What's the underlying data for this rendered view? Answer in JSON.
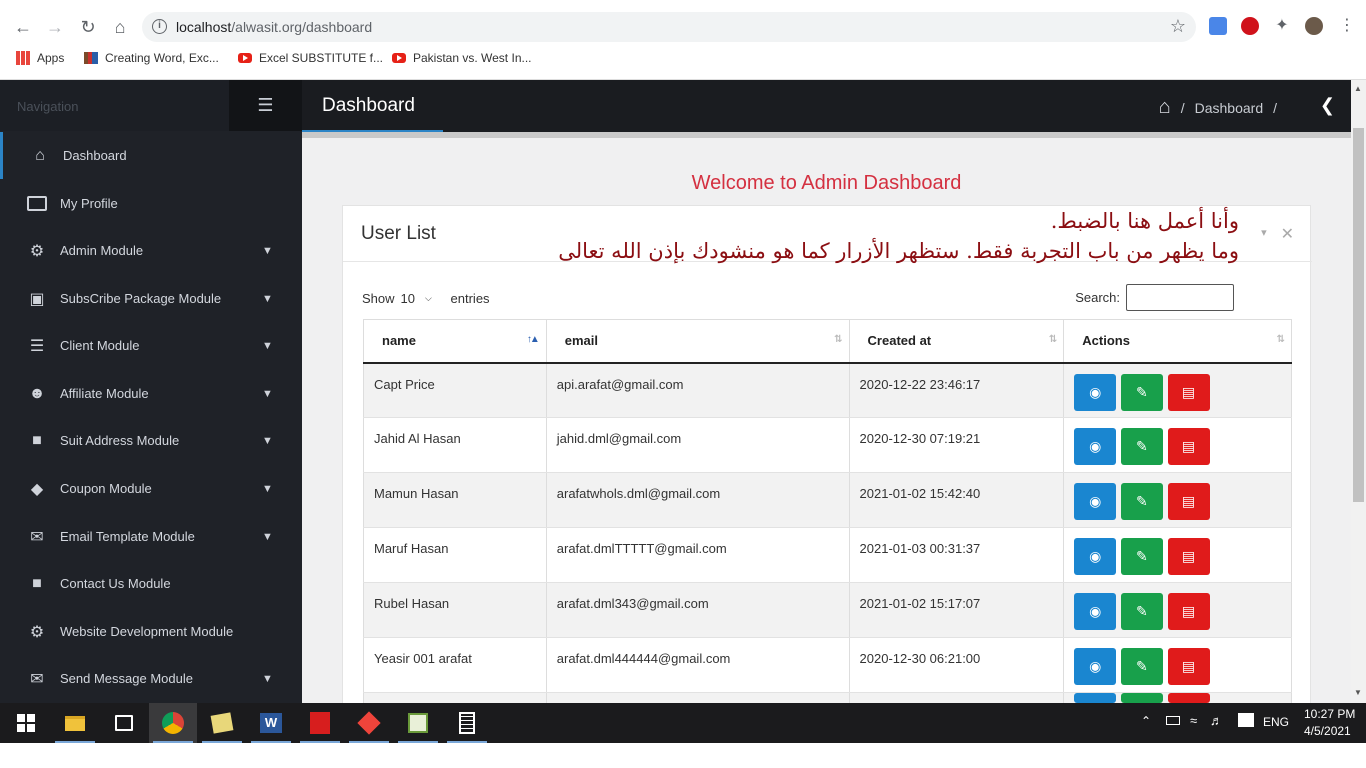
{
  "browser": {
    "url_host": "localhost",
    "url_path": "/alwasit.org/dashboard",
    "bookmarks": [
      {
        "label": "Apps"
      },
      {
        "label": "Creating Word, Exc..."
      },
      {
        "label": "Excel SUBSTITUTE f..."
      },
      {
        "label": "Pakistan vs. West In..."
      }
    ]
  },
  "sidebar": {
    "nav_label": "Navigation",
    "items": [
      {
        "label": "Dashboard",
        "icon": "home-icon",
        "has_submenu": false,
        "active": true
      },
      {
        "label": "My Profile",
        "icon": "id-card-icon",
        "has_submenu": false
      },
      {
        "label": "Admin Module",
        "icon": "users-cog-icon",
        "has_submenu": true
      },
      {
        "label": "SubsCribe Package Module",
        "icon": "box-icon",
        "has_submenu": true
      },
      {
        "label": "Client Module",
        "icon": "list-icon",
        "has_submenu": true
      },
      {
        "label": "Affiliate Module",
        "icon": "users-icon",
        "has_submenu": true
      },
      {
        "label": "Suit Address Module",
        "icon": "address-book-icon",
        "has_submenu": true
      },
      {
        "label": "Coupon Module",
        "icon": "tags-icon",
        "has_submenu": true
      },
      {
        "label": "Email Template Module",
        "icon": "envelope-icon",
        "has_submenu": true
      },
      {
        "label": "Contact Us Module",
        "icon": "comment-icon",
        "has_submenu": false
      },
      {
        "label": "Website Development Module",
        "icon": "user-cog-icon",
        "has_submenu": false
      },
      {
        "label": "Send Message Module",
        "icon": "mail-bulk-icon",
        "has_submenu": true
      }
    ]
  },
  "header": {
    "title": "Dashboard",
    "breadcrumb": {
      "current": "Dashboard",
      "separator": "/"
    }
  },
  "main": {
    "welcome": "Welcome to Admin Dashboard",
    "card_title": "User List",
    "annotation_line1": "وأنا أعمل هنا بالضبط.",
    "annotation_line2": "وما يظهر من باب التجربة فقط. ستظهر الأزرار كما هو منشودك بإذن الله تعالى",
    "show_label": "Show",
    "entries_value": "10",
    "entries_label": "entries",
    "search_label": "Search:",
    "search_value": "",
    "columns": [
      "name",
      "email",
      "Created at",
      "Actions"
    ],
    "rows": [
      {
        "name": "Capt Price",
        "email": "api.arafat@gmail.com",
        "created": "2020-12-22 23:46:17"
      },
      {
        "name": "Jahid Al Hasan",
        "email": "jahid.dml@gmail.com",
        "created": "2020-12-30 07:19:21"
      },
      {
        "name": "Mamun Hasan",
        "email": "arafatwhols.dml@gmail.com",
        "created": "2021-01-02 15:42:40"
      },
      {
        "name": "Maruf Hasan",
        "email": "arafat.dmlTTTTT@gmail.com",
        "created": "2021-01-03 00:31:37"
      },
      {
        "name": "Rubel Hasan",
        "email": "arafat.dml343@gmail.com",
        "created": "2021-01-02 15:17:07"
      },
      {
        "name": "Yeasir 001 arafat",
        "email": "arafat.dml444444@gmail.com",
        "created": "2020-12-30 06:21:00"
      }
    ]
  },
  "taskbar": {
    "language": "ENG",
    "time": "10:27 PM",
    "date": "4/5/2021"
  },
  "colors": {
    "sidebar_bg": "#1f2228",
    "header_bg": "#1a1c20",
    "accent": "#2b84c6",
    "welcome": "#d43040",
    "view": "#1a86d0",
    "edit": "#18a04b",
    "delete": "#e01b1b"
  }
}
